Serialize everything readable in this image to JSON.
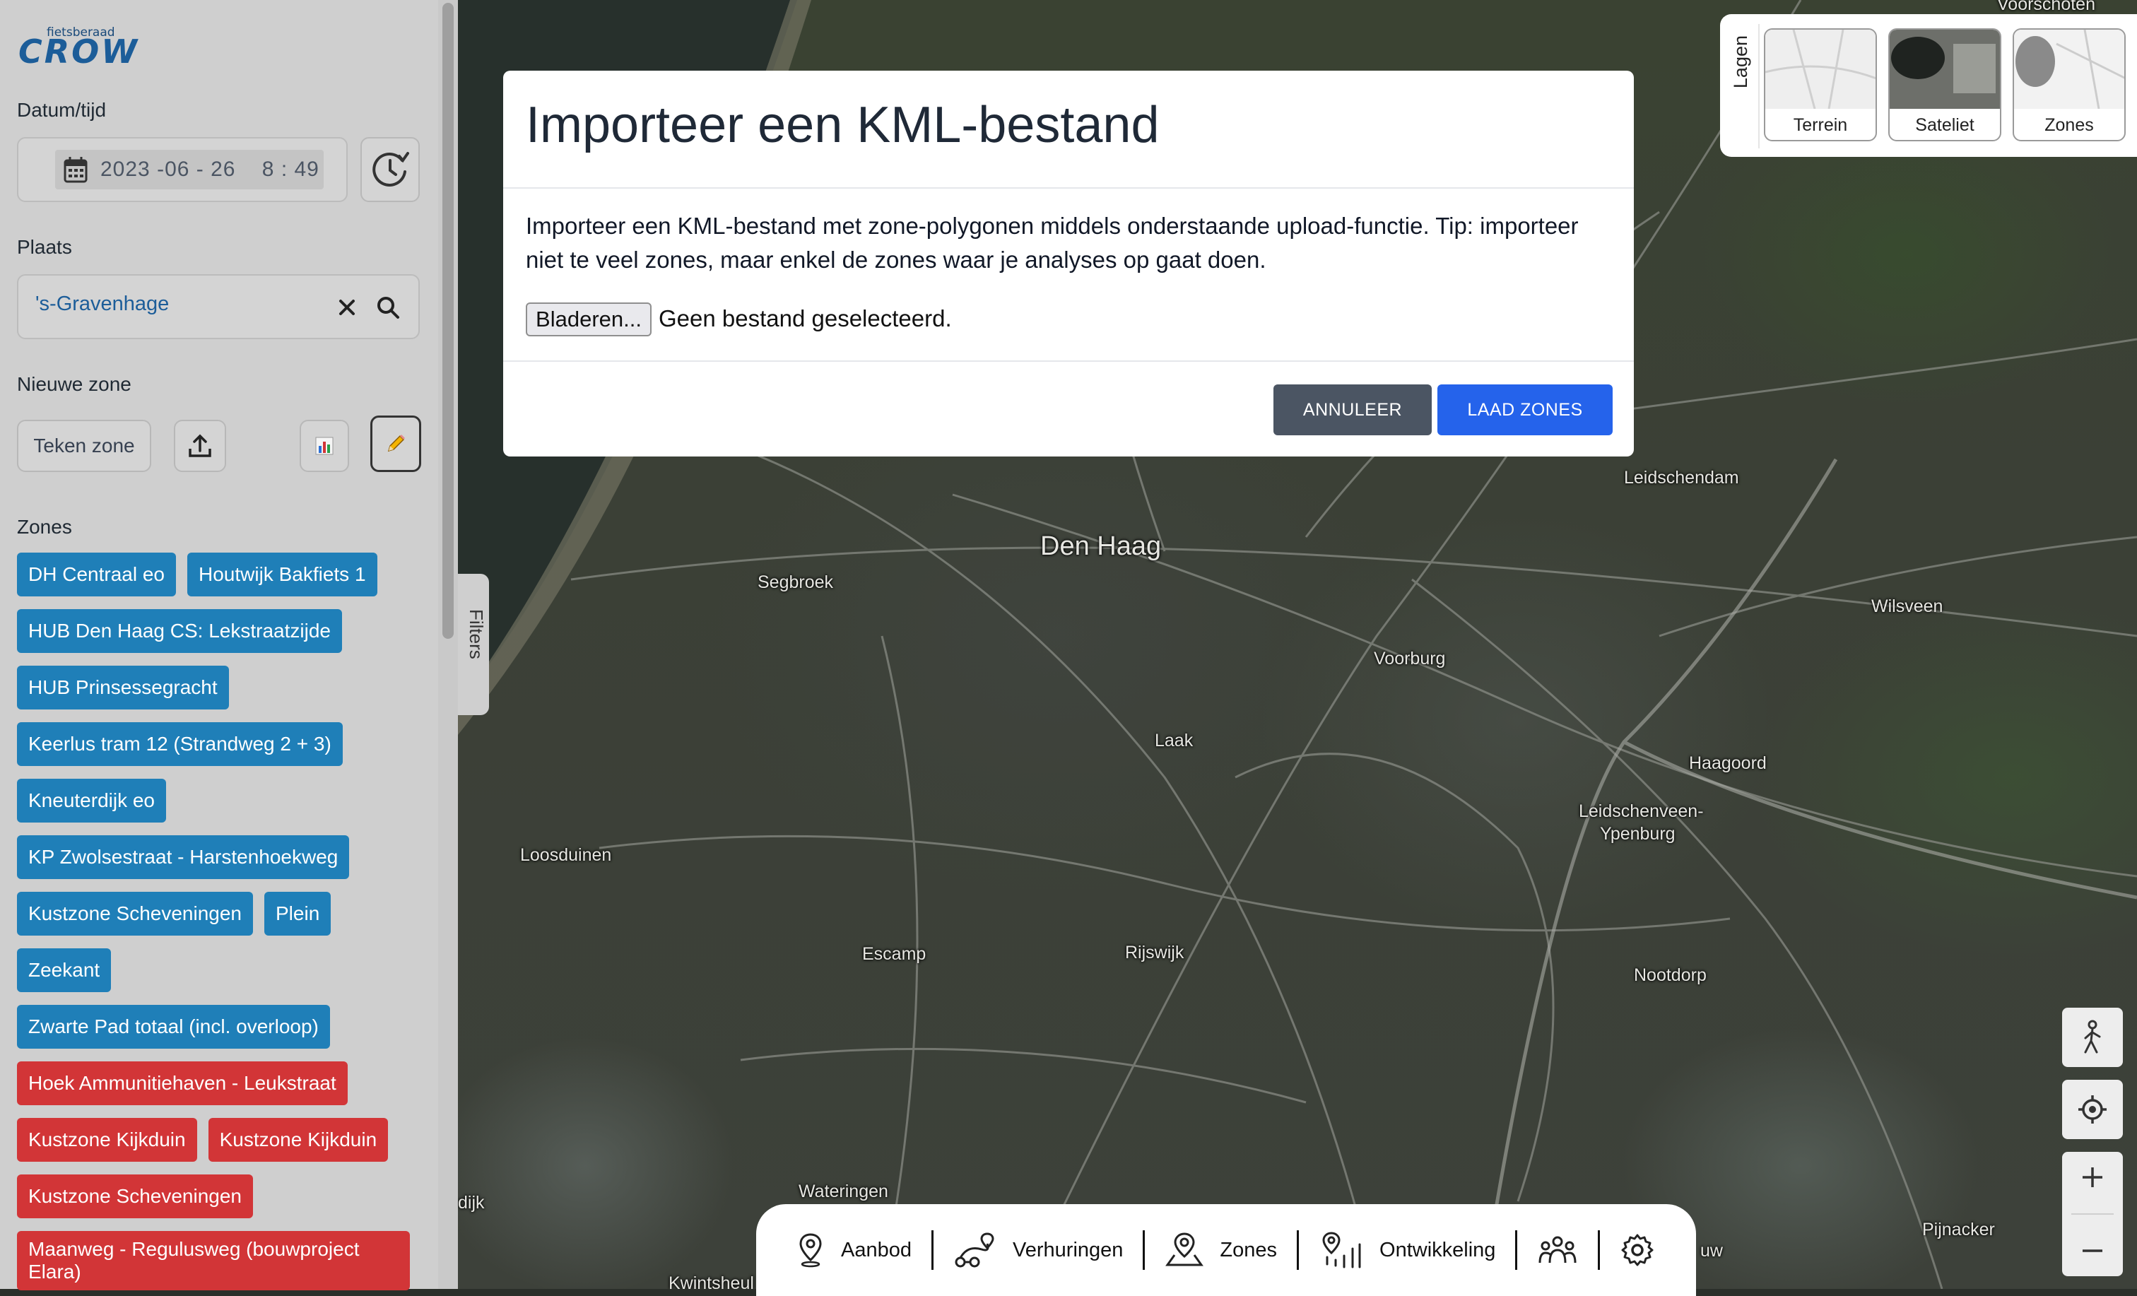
{
  "sidebar": {
    "logo_small": "fietsberaad",
    "logo_big": "CROW",
    "datetime_label": "Datum/tijd",
    "datetime_value": "2023 -06 - 26    8 : 49",
    "place_label": "Plaats",
    "place_value": "'s-Gravenhage",
    "new_zone_label": "Nieuwe zone",
    "draw_zone_button": "Teken zone",
    "zones_label": "Zones",
    "zones": [
      {
        "label": "DH Centraal eo",
        "color": "blue"
      },
      {
        "label": "Houtwijk Bakfiets 1",
        "color": "blue"
      },
      {
        "label": "HUB Den Haag CS: Lekstraatzijde",
        "color": "blue"
      },
      {
        "label": "HUB Prinsessegracht",
        "color": "blue"
      },
      {
        "label": "Keerlus tram 12 (Strandweg 2 + 3)",
        "color": "blue"
      },
      {
        "label": "Kneuterdijk eo",
        "color": "blue"
      },
      {
        "label": "KP Zwolsestraat - Harstenhoekweg",
        "color": "blue"
      },
      {
        "label": "Kustzone Scheveningen",
        "color": "blue"
      },
      {
        "label": "Plein",
        "color": "blue"
      },
      {
        "label": "Zeekant",
        "color": "blue"
      },
      {
        "label": "Zwarte Pad totaal (incl. overloop)",
        "color": "blue"
      },
      {
        "label": "Hoek Ammunitiehaven - Leukstraat",
        "color": "red"
      },
      {
        "label": "Kustzone Kijkduin",
        "color": "red"
      },
      {
        "label": "Kustzone Kijkduin",
        "color": "red"
      },
      {
        "label": "Kustzone Scheveningen",
        "color": "red"
      },
      {
        "label": "Maanweg - Regulusweg (bouwproject Elara)",
        "color": "red"
      }
    ],
    "filters_tab": "Filters"
  },
  "modal": {
    "title": "Importeer een KML-bestand",
    "body": "Importeer een KML-bestand met zone-polygonen middels onderstaande upload-functie. Tip: importeer niet te veel zones, maar enkel de zones waar je analyses op gaat doen.",
    "browse_button": "Bladeren...",
    "no_file_text": "Geen bestand geselecteerd.",
    "cancel_button": "ANNULEER",
    "load_button": "LAAD ZONES"
  },
  "layers": {
    "label": "Lagen",
    "items": [
      "Terrein",
      "Sateliet",
      "Zones"
    ]
  },
  "map_labels": {
    "voorschoten": "Voorschoten",
    "leidschendam": "Leidschendam",
    "den_haag": "Den Haag",
    "segbroek": "Segbroek",
    "wilsveen": "Wilsveen",
    "voorburg": "Voorburg",
    "laak": "Laak",
    "haagoord": "Haagoord",
    "leidschenveen": "Leidschenveen-",
    "ypenburg": "Ypenburg",
    "loosduinen": "Loosduinen",
    "escamp": "Escamp",
    "rijswijk": "Rijswijk",
    "nootdorp": "Nootdorp",
    "wateringen": "Wateringen",
    "pijnacker": "Pijnacker",
    "dijk": "dijk",
    "kwintsheul": "Kwintsheul",
    "uw": "uw"
  },
  "bottom_nav": {
    "items": [
      "Aanbod",
      "Verhuringen",
      "Zones",
      "Ontwikkeling"
    ]
  },
  "colors": {
    "zone_blue": "#1f7fb8",
    "zone_red": "#d23537",
    "primary_button": "#2563eb",
    "secondary_button": "#4b5563"
  }
}
